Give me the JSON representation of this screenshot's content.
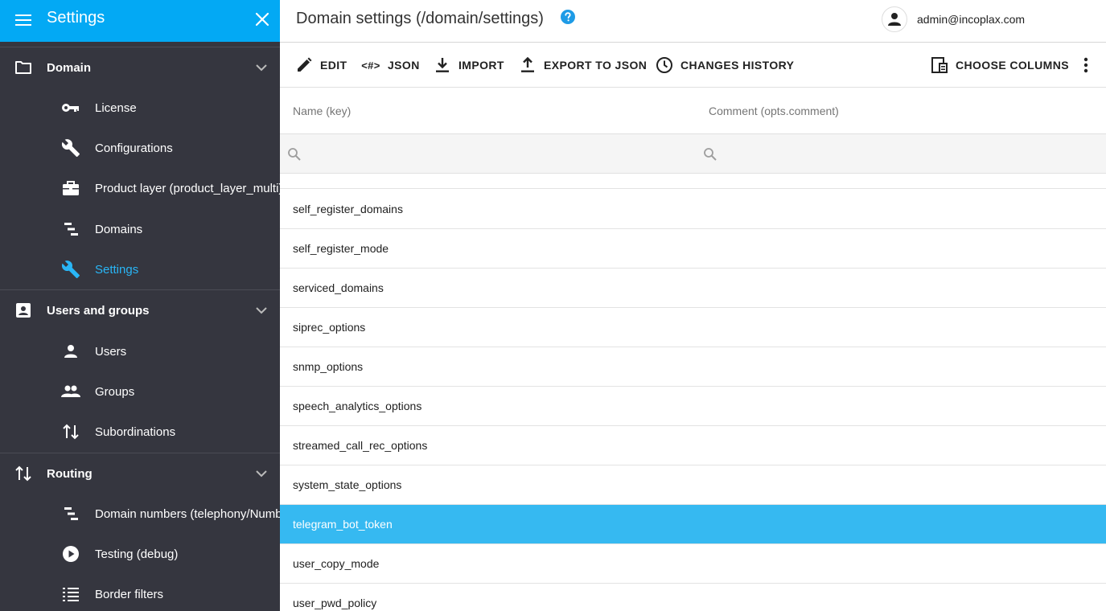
{
  "sidebar": {
    "title": "Settings",
    "sections": [
      {
        "label": "Domain",
        "icon": "folder-icon",
        "items": [
          {
            "label": "License",
            "icon": "key-icon",
            "active": false
          },
          {
            "label": "Configurations",
            "icon": "wrench-icon",
            "active": false
          },
          {
            "label": "Product layer (product_layer_multi)",
            "icon": "briefcase-icon",
            "active": false
          },
          {
            "label": "Domains",
            "icon": "tree-list-icon",
            "active": false
          },
          {
            "label": "Settings",
            "icon": "wrench-icon",
            "active": true
          }
        ]
      },
      {
        "label": "Users and groups",
        "icon": "contact-box-icon",
        "items": [
          {
            "label": "Users",
            "icon": "person-icon",
            "active": false
          },
          {
            "label": "Groups",
            "icon": "people-icon",
            "active": false
          },
          {
            "label": "Subordinations",
            "icon": "swap-vertical-icon",
            "active": false
          }
        ]
      },
      {
        "label": "Routing",
        "icon": "swap-vertical-icon",
        "items": [
          {
            "label": "Domain numbers (telephony/Numbers)",
            "icon": "tree-list-icon",
            "active": false
          },
          {
            "label": "Testing (debug)",
            "icon": "play-circle-icon",
            "active": false
          },
          {
            "label": "Border filters",
            "icon": "list-numbered-icon",
            "active": false
          }
        ]
      }
    ]
  },
  "header": {
    "title": "Domain settings (/domain/settings)",
    "user": "admin@incoplax.com"
  },
  "toolbar": {
    "edit": "EDIT",
    "json": "JSON",
    "import": "IMPORT",
    "export": "EXPORT TO JSON",
    "history": "CHANGES HISTORY",
    "columns": "CHOOSE COLUMNS"
  },
  "table": {
    "columns": [
      "Name (key)",
      "Comment (opts.comment)"
    ],
    "filters": [
      "",
      ""
    ],
    "rows": [
      {
        "name": "self_register_domains",
        "comment": "",
        "selected": false
      },
      {
        "name": "self_register_mode",
        "comment": "",
        "selected": false
      },
      {
        "name": "serviced_domains",
        "comment": "",
        "selected": false
      },
      {
        "name": "siprec_options",
        "comment": "",
        "selected": false
      },
      {
        "name": "snmp_options",
        "comment": "",
        "selected": false
      },
      {
        "name": "speech_analytics_options",
        "comment": "",
        "selected": false
      },
      {
        "name": "streamed_call_rec_options",
        "comment": "",
        "selected": false
      },
      {
        "name": "system_state_options",
        "comment": "",
        "selected": false
      },
      {
        "name": "telegram_bot_token",
        "comment": "",
        "selected": true
      },
      {
        "name": "user_copy_mode",
        "comment": "",
        "selected": false
      },
      {
        "name": "user_pwd_policy",
        "comment": "",
        "selected": false
      }
    ]
  },
  "colors": {
    "accent": "#03a9f4",
    "sidebar_bg": "#35363f",
    "selected_row": "#36b9f1",
    "active_item": "#29b6f6"
  }
}
